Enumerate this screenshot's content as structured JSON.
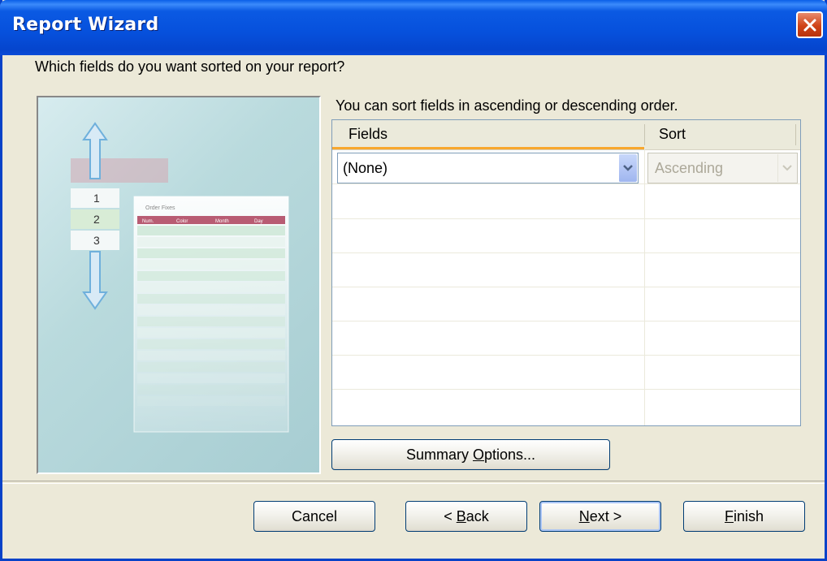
{
  "window": {
    "title": "Report Wizard"
  },
  "question": "Which fields do you want sorted on your report?",
  "instruction": "You can sort fields in ascending or descending order.",
  "grid": {
    "headers": {
      "fields": "Fields",
      "sort": "Sort"
    },
    "rows": [
      {
        "field": "(None)",
        "sort": "Ascending"
      }
    ]
  },
  "illustration": {
    "steps": [
      "1",
      "2",
      "3"
    ],
    "table_title": "Order Fixes",
    "columns": [
      "Num.",
      "Color",
      "Month",
      "Day"
    ]
  },
  "buttons": {
    "summary_prefix": "Summary ",
    "summary_mnemonic": "O",
    "summary_suffix": "ptions...",
    "cancel": "Cancel",
    "back_prefix": "< ",
    "back_mnemonic": "B",
    "back_suffix": "ack",
    "next_mnemonic": "N",
    "next_suffix": "ext >",
    "finish_mnemonic": "F",
    "finish_suffix": "inish"
  },
  "colors": {
    "titlebar": "#0650dc",
    "accent": "#f8a82e",
    "close": "#cf4317"
  }
}
